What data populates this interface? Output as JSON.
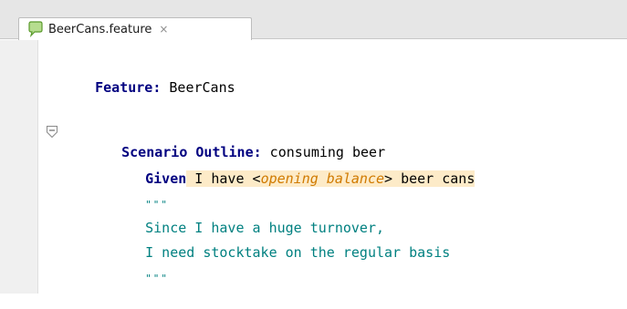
{
  "tab": {
    "icon": "cucumber-feature-icon",
    "label": "BeerCans.feature",
    "close_glyph": "×"
  },
  "editor": {
    "feature_keyword": "Feature:",
    "feature_name": " BeerCans",
    "scenario_keyword": "Scenario Outline:",
    "scenario_name": " consuming beer",
    "step_keyword": "Given",
    "step_text_pre": " I have <",
    "step_param": "opening balance",
    "step_text_post": "> beer cans",
    "docstring_open": "\"\"\"",
    "docstring_line1": "Since I have a huge turnover,",
    "docstring_line2": "I need stocktake on the regular basis",
    "docstring_close": "\"\"\""
  },
  "colors": {
    "keyword": "#000080",
    "param": "#d07a00",
    "docstring": "#008080",
    "step_highlight": "#fdebc8"
  }
}
